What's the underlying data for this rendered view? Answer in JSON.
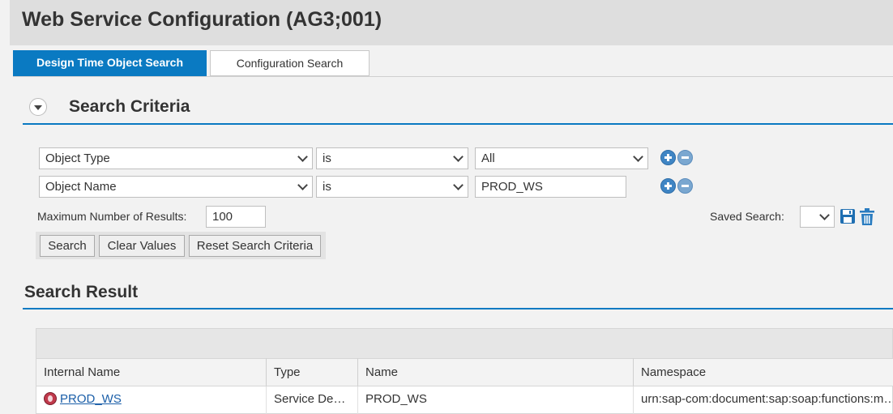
{
  "window": {
    "title": "Web Service Configuration (AG3;001)"
  },
  "tabs": [
    {
      "label": "Design Time Object Search",
      "active": true
    },
    {
      "label": "Configuration Search",
      "active": false
    }
  ],
  "criteria": {
    "heading": "Search Criteria",
    "rows": [
      {
        "field": "Object Type",
        "operator": "is",
        "value": "All",
        "value_kind": "dropdown"
      },
      {
        "field": "Object Name",
        "operator": "is",
        "value": "PROD_WS",
        "value_kind": "text"
      }
    ],
    "max_results_label": "Maximum Number of Results:",
    "max_results_value": "100",
    "saved_search_label": "Saved Search:",
    "saved_search_value": "",
    "buttons": {
      "search": "Search",
      "clear": "Clear Values",
      "reset": "Reset Search Criteria"
    }
  },
  "result": {
    "heading": "Search Result",
    "columns": [
      "Internal Name",
      "Type",
      "Name",
      "Namespace"
    ],
    "rows": [
      {
        "internal_name": "PROD_WS",
        "type": "Service De…",
        "name": "PROD_WS",
        "namespace": "urn:sap-com:document:sap:soap:functions:m…"
      }
    ]
  },
  "colors": {
    "accent": "#0a7ac2",
    "link": "#1a5ea8"
  },
  "icons": [
    "chevron-down-icon",
    "add-icon",
    "remove-icon",
    "save-icon",
    "trash-icon",
    "web-service-icon"
  ]
}
